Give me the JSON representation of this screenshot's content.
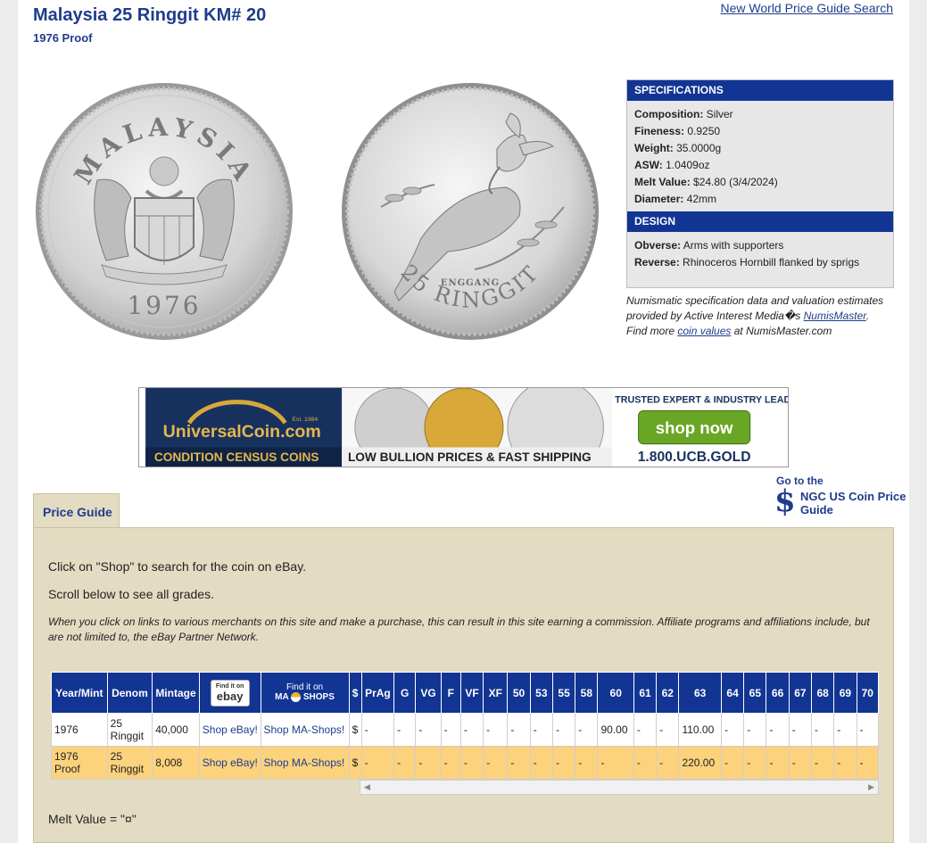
{
  "header": {
    "title": "Malaysia 25 Ringgit KM# 20",
    "subtitle": "1976 Proof",
    "search_link": "New World Price Guide Search"
  },
  "coins": {
    "obverse": {
      "top_text": "MALAYSIA",
      "year": "1976"
    },
    "reverse": {
      "top_text": "ENGGANG",
      "denomination_text": "25 RINGGIT"
    }
  },
  "specifications": {
    "heading": "SPECIFICATIONS",
    "rows": [
      {
        "label": "Composition:",
        "value": "Silver"
      },
      {
        "label": "Fineness:",
        "value": "0.9250"
      },
      {
        "label": "Weight:",
        "value": "35.0000g"
      },
      {
        "label": "ASW:",
        "value": "1.0409oz"
      },
      {
        "label": "Melt Value:",
        "value": "$24.80 (3/4/2024)"
      },
      {
        "label": "Diameter:",
        "value": "42mm"
      }
    ],
    "design_heading": "DESIGN",
    "design_rows": [
      {
        "label": "Obverse:",
        "value": "Arms with supporters"
      },
      {
        "label": "Reverse:",
        "value": "Rhinoceros Hornbill flanked by sprigs"
      }
    ],
    "note_line1": "Numismatic specification data and valuation estimates",
    "note_line2_pre": "provided by Active Interest Media�s ",
    "note_line2_link": "NumisMaster",
    "note_line2_post": ".",
    "note_line3_pre": "Find more ",
    "note_line3_link": "coin values",
    "note_line3_post": " at NumisMaster.com"
  },
  "banner": {
    "site": "UniversalCoin.com",
    "est": "Est. 1984",
    "tagline1": "CONDITION CENSUS COINS",
    "tagline2": "LOW BULLION PRICES & FAST SHIPPING",
    "trusted": "TRUSTED EXPERT & INDUSTRY LEADE...",
    "cta": "shop now",
    "phone": "1.800.UCB.GOLD"
  },
  "price_guide": {
    "tab_label": "Price Guide",
    "ngc_goto": "Go to the",
    "ngc_label": "NGC US Coin Price Guide",
    "instruction1": "Click on \"Shop\" to search for the coin on eBay.",
    "instruction2": "Scroll below to see all grades.",
    "disclaimer": "When you click on links to various merchants on this site and make a purchase, this can result in this site earning a commission. Affiliate programs and affiliations include, but are not limited to, the eBay Partner Network.",
    "melt_note": "Melt Value = \"¤\"",
    "columns": {
      "year_mint": "Year/Mint",
      "denom": "Denom",
      "mintage": "Mintage",
      "ebay_find": "Find it on",
      "ebay_logo": "ebay",
      "ma_find": "Find it on",
      "ma_logo": "MA",
      "ma_shops": "SHOPS",
      "dollar": "$",
      "grades": [
        "PrAg",
        "G",
        "VG",
        "F",
        "VF",
        "XF",
        "50",
        "53",
        "55",
        "58",
        "60",
        "61",
        "62",
        "63",
        "64",
        "65",
        "66",
        "67",
        "68",
        "69",
        "70"
      ]
    },
    "rows": [
      {
        "year": "1976",
        "denom": "25 Ringgit",
        "mintage": "40,000",
        "ebay": "Shop eBay!",
        "ma": "Shop MA-Shops!",
        "dollar": "$",
        "values": [
          "-",
          "-",
          "-",
          "-",
          "-",
          "-",
          "-",
          "-",
          "-",
          "-",
          "90.00",
          "-",
          "-",
          "110.00",
          "-",
          "-",
          "-",
          "-",
          "-",
          "-",
          "-"
        ]
      },
      {
        "year": "1976 Proof",
        "denom": "25 Ringgit",
        "mintage": "8,008",
        "ebay": "Shop eBay!",
        "ma": "Shop MA-Shops!",
        "dollar": "$",
        "values": [
          "-",
          "-",
          "-",
          "-",
          "-",
          "-",
          "-",
          "-",
          "-",
          "-",
          "-",
          "-",
          "-",
          "220.00",
          "-",
          "-",
          "-",
          "-",
          "-",
          "-",
          "-"
        ]
      }
    ]
  },
  "colors": {
    "navy": "#123594",
    "link": "#1f3c8c",
    "tan_panel": "#e4dcc2",
    "proof_row": "#fcd27d"
  }
}
